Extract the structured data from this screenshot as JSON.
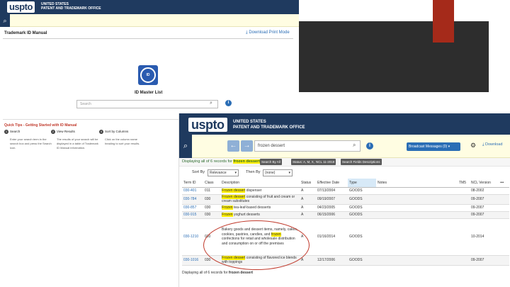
{
  "colors": {
    "uspto_navy": "#1f3a5f",
    "toolbar_yellow": "#fffde2",
    "highlight": "#ffef00",
    "link_blue": "#2a6db5",
    "slide_dark": "#2d2d2d",
    "slide_red": "#a52a1a",
    "annotation_red": "#c0392b"
  },
  "back_page": {
    "logo": "uspto",
    "office_line1": "UNITED STATES",
    "office_line2": "PATENT AND TRADEMARK OFFICE",
    "title": "Trademark ID Manual",
    "download_label": "Download Print Mode",
    "badge_text": "ID",
    "master_list": "ID Master List",
    "search_placeholder": "Search",
    "quick_tips": "Quick Tips - Getting Started with ID Manual",
    "steps": [
      {
        "num": "1",
        "title": "Search",
        "text": "Enter your search term in the search box and press the Search icon."
      },
      {
        "num": "2",
        "title": "View Results",
        "text": "The results of your search will be displayed in a table of Trademark ID Manual information."
      },
      {
        "num": "4",
        "title": "Sort by Columns",
        "text": "Click on the column name heading to sort your results."
      }
    ]
  },
  "front_page": {
    "logo": "uspto",
    "office_line1": "UNITED STATES",
    "office_line2": "PATENT AND TRADEMARK OFFICE",
    "search_value": "frozen dessert",
    "back_arrow": "←",
    "forward_arrow": "→",
    "broadcast_label": "Broadcast Messages (0)",
    "broadcast_caret": "▾",
    "download_label": "Download",
    "display_prefix": "Displaying all of 6 records for",
    "display_term": "frozen dessert",
    "chips": [
      "Search By All",
      "Status: A, M, X, D",
      "NCL 11-2019",
      "Search Fields Descriptions"
    ],
    "sort_by_label": "Sort By",
    "sort_by_value": "Relevance",
    "then_by_label": "Then By",
    "then_by_value": "(none)",
    "columns": [
      "Term ID",
      "Class",
      "Description",
      "Status",
      "Effective Date",
      "Type",
      "Notes",
      "TM5",
      "NCL Version"
    ],
    "more": "•••",
    "rows": [
      {
        "term_id": "030-401",
        "class": "011",
        "desc_pre": "",
        "desc_hl": "Frozen dessert",
        "desc_post": " dispenser",
        "status": "A",
        "date": "07/13/2004",
        "type": "GOODS",
        "notes": "",
        "tm5": "",
        "ncl": "08-2002"
      },
      {
        "term_id": "030-784",
        "class": "030",
        "desc_pre": "",
        "desc_hl": "Frozen dessert",
        "desc_post": " consisting of fruit and cream or cream substitutes",
        "status": "A",
        "date": "09/19/2007",
        "type": "GOODS",
        "notes": "",
        "tm5": "",
        "ncl": "09-2007"
      },
      {
        "term_id": "030-857",
        "class": "030",
        "desc_pre": "",
        "desc_hl": "Frozen",
        "desc_post": " tea-leaf-based desserts",
        "status": "A",
        "date": "04/23/2005",
        "type": "GOODS",
        "notes": "",
        "tm5": "",
        "ncl": "09-2007"
      },
      {
        "term_id": "030-915",
        "class": "030",
        "desc_pre": "",
        "desc_hl": "Frozen",
        "desc_post": " yoghurt desserts",
        "status": "A",
        "date": "06/15/2006",
        "type": "GOODS",
        "notes": "",
        "tm5": "",
        "ncl": "09-2007"
      },
      {
        "term_id": "030-1210",
        "class": "030",
        "desc_pre": "Bakery goods and dessert items, namely, cakes, cookies, pastries, candies, and ",
        "desc_hl": "frozen",
        "desc_post": " confections for retail and wholesale distribution and consumption on or off the premises",
        "status": "A",
        "date": "01/16/2014",
        "type": "GOODS",
        "notes": "",
        "tm5": "",
        "ncl": "10-2014"
      },
      {
        "term_id": "030-1016",
        "class": "030",
        "desc_pre": "",
        "desc_hl": "Frozen dessert",
        "desc_post": " consisting of flavored ice blends with toppings",
        "status": "A",
        "date": "12/17/2006",
        "type": "GOODS",
        "notes": "",
        "tm5": "",
        "ncl": "09-2007"
      }
    ],
    "footer_prefix": "Displaying all of 6 records for",
    "footer_term": "frozen dessert"
  }
}
